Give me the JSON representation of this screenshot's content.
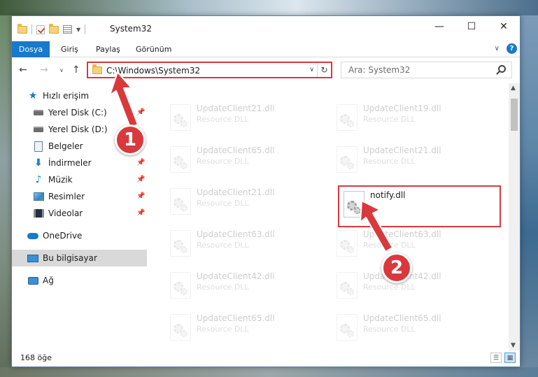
{
  "window": {
    "title": "System32",
    "controls": {
      "minimize": "—",
      "maximize": "☐",
      "close": "✕"
    }
  },
  "ribbon": {
    "tabs": [
      "Dosya",
      "Giriş",
      "Paylaş",
      "Görünüm"
    ],
    "help": "?"
  },
  "navigation": {
    "address": "C:\\Windows\\System32",
    "search_placeholder": "Ara: System32"
  },
  "sidebar": {
    "items": [
      {
        "label": "Hızlı erişim",
        "icon": "star-icon",
        "pinned": false
      },
      {
        "label": "Yerel Disk (C:)",
        "icon": "disk-icon",
        "pinned": true
      },
      {
        "label": "Yerel Disk (D:)",
        "icon": "disk-icon",
        "pinned": true
      },
      {
        "label": "Belgeler",
        "icon": "documents-icon",
        "pinned": true
      },
      {
        "label": "İndirmeler",
        "icon": "download-icon",
        "pinned": true
      },
      {
        "label": "Müzik",
        "icon": "music-icon",
        "pinned": true
      },
      {
        "label": "Resimler",
        "icon": "pictures-icon",
        "pinned": true
      },
      {
        "label": "Videolar",
        "icon": "videos-icon",
        "pinned": true
      },
      {
        "label": "OneDrive",
        "icon": "onedrive-icon",
        "pinned": false
      },
      {
        "label": "Bu bilgisayar",
        "icon": "this-pc-icon",
        "pinned": false,
        "selected": true
      },
      {
        "label": "Ağ",
        "icon": "network-icon",
        "pinned": false
      }
    ]
  },
  "files": [
    {
      "name": "UpdateClient21.dll",
      "type": "Resource DLL",
      "faded": true
    },
    {
      "name": "UpdateClient19.dll",
      "type": "Resource DLL",
      "faded": true
    },
    {
      "name": "UpdateClient65.dll",
      "type": "Resource DLL",
      "faded": true
    },
    {
      "name": "UpdateClient21.dll",
      "type": "Resource DLL",
      "faded": true
    },
    {
      "name": "UpdateClient21.dll",
      "type": "Resource DLL",
      "faded": true
    },
    {
      "name": "notify.dll",
      "type": "",
      "faded": false
    },
    {
      "name": "UpdateClient63.dll",
      "type": "Resource DLL",
      "faded": true
    },
    {
      "name": "UpdateClient63.dll",
      "type": "Resource DLL",
      "faded": true
    },
    {
      "name": "UpdateClient42.dll",
      "type": "Resource DLL",
      "faded": true
    },
    {
      "name": "UpdateClient42.dll",
      "type": "Resource DLL",
      "faded": true
    },
    {
      "name": "UpdateClient65.dll",
      "type": "Resource DLL",
      "faded": true
    },
    {
      "name": "UpdateClient65.dll",
      "type": "Resource DLL",
      "faded": true
    }
  ],
  "status": {
    "count": "168 öğe"
  },
  "annotations": {
    "step1": "1",
    "step2": "2",
    "color": "#d9393d"
  },
  "colors": {
    "accent": "#1979ca",
    "highlight": "#d9393d"
  }
}
